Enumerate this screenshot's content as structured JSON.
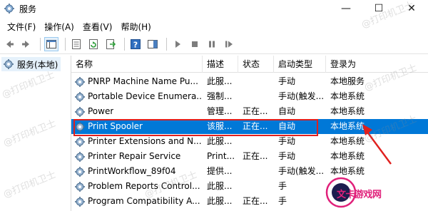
{
  "window": {
    "title": "服务",
    "minimize": "—",
    "maximize": "☐",
    "close": "✕"
  },
  "menu": [
    "文件(F)",
    "操作(A)",
    "查看(V)",
    "帮助(H)"
  ],
  "toolbar": {
    "icons": [
      "back-icon",
      "forward-icon",
      "show-hide-tree-icon",
      "properties-icon",
      "refresh-icon",
      "export-list-icon",
      "help-icon",
      "show-pane-icon",
      "start-icon",
      "stop-icon",
      "pause-icon",
      "restart-icon"
    ]
  },
  "tree": {
    "root_label": "服务(本地)"
  },
  "columns": {
    "name": "名称",
    "desc": "描述",
    "status": "状态",
    "startup": "启动类型",
    "logon": "登录为"
  },
  "services": [
    {
      "name": "PNRP Machine Name Pu...",
      "desc": "此服...",
      "status": "",
      "startup": "手动",
      "logon": "本地服务"
    },
    {
      "name": "Portable Device Enumera...",
      "desc": "强制...",
      "status": "",
      "startup": "手动(触发...",
      "logon": "本地系统"
    },
    {
      "name": "Power",
      "desc": "管理...",
      "status": "正在...",
      "startup": "自动",
      "logon": "本地系统"
    },
    {
      "name": "Print Spooler",
      "desc": "该服...",
      "status": "正在...",
      "startup": "自动",
      "logon": "本地系统"
    },
    {
      "name": "Printer Extensions and N...",
      "desc": "此服...",
      "status": "",
      "startup": "手动",
      "logon": "本地系统"
    },
    {
      "name": "Printer Repair Service",
      "desc": "Print...",
      "status": "正在...",
      "startup": "手动",
      "logon": "本地系统"
    },
    {
      "name": "PrintWorkflow_89f04",
      "desc": "提供...",
      "status": "",
      "startup": "手动(触发...",
      "logon": "本地系统"
    },
    {
      "name": "Problem Reports Control...",
      "desc": "此服...",
      "status": "",
      "startup": "手",
      "logon": ""
    },
    {
      "name": "Program Compatibility A...",
      "desc": "此服...",
      "status": "正在...",
      "startup": "手",
      "logon": ""
    }
  ],
  "selected_index": 3,
  "watermarks": [
    "@打印机卫士",
    "@打印机卫士",
    "@打印机卫士",
    "@打印机卫士",
    "@打印机卫士",
    "@打印机卫士",
    "@打印机卫士"
  ],
  "logo_text": "文卡游戏网",
  "colors": {
    "selection": "#0078d7",
    "highlight_box": "#e0201e",
    "logo": "#e0207a"
  }
}
